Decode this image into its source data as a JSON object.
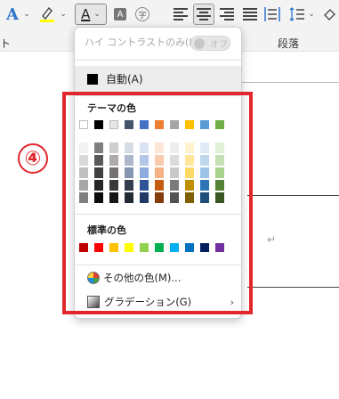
{
  "ribbon": {
    "section_left_label": "ト",
    "section_paragraph_label": "段落"
  },
  "dropdown": {
    "high_contrast_label": "ハイ コントラストのみ(H)",
    "high_contrast_toggle": "オフ",
    "automatic_label": "自動(A)",
    "theme_colors_title": "テーマの色",
    "theme_top_row": [
      "#ffffff",
      "#000000",
      "#e7e6e6",
      "#44546a",
      "#4472c4",
      "#ed7d31",
      "#a5a5a5",
      "#ffc000",
      "#5b9bd5",
      "#70ad47"
    ],
    "theme_shades": [
      [
        "#f2f2f2",
        "#d9d9d9",
        "#bfbfbf",
        "#a6a6a6",
        "#808080"
      ],
      [
        "#7f7f7f",
        "#595959",
        "#404040",
        "#262626",
        "#0d0d0d"
      ],
      [
        "#d0cece",
        "#aeaaaa",
        "#757171",
        "#3a3838",
        "#171616"
      ],
      [
        "#d6dce4",
        "#adb9ca",
        "#8496b0",
        "#333f4f",
        "#222a35"
      ],
      [
        "#dae3f3",
        "#b4c7e7",
        "#8faadc",
        "#2f5597",
        "#1f3864"
      ],
      [
        "#fbe5d6",
        "#f8cbad",
        "#f4b183",
        "#c55a11",
        "#843c0c"
      ],
      [
        "#ededed",
        "#dbdbdb",
        "#c9c9c9",
        "#7b7b7b",
        "#525252"
      ],
      [
        "#fff2cc",
        "#ffe699",
        "#ffd966",
        "#bf9000",
        "#7f6000"
      ],
      [
        "#deebf7",
        "#bdd7ee",
        "#9dc3e6",
        "#2e75b6",
        "#1f4e79"
      ],
      [
        "#e2f0d9",
        "#c5e0b4",
        "#a9d18e",
        "#548235",
        "#385723"
      ]
    ],
    "standard_colors_title": "標準の色",
    "standard_colors": [
      "#c00000",
      "#ff0000",
      "#ffc000",
      "#ffff00",
      "#92d050",
      "#00b050",
      "#00b0f0",
      "#0070c0",
      "#002060",
      "#7030a0"
    ],
    "more_colors_label": "その他の色(M)...",
    "gradient_label": "グラデーション(G)"
  },
  "annotation": {
    "step_number": "④"
  },
  "colors": {
    "annotation_red": "#e1262c",
    "ribbon_bg": "#f3f3f3"
  }
}
